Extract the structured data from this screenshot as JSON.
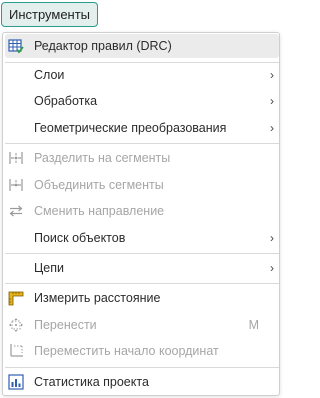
{
  "menubar": {
    "tools_label": "Инструменты"
  },
  "menu": {
    "drc": "Редактор правил (DRC)",
    "layers": "Слои",
    "processing": "Обработка",
    "geometry": "Геометрические преобразования",
    "split": "Разделить на сегменты",
    "merge": "Объединить сегменты",
    "reverse": "Сменить направление",
    "find": "Поиск объектов",
    "chains": "Цепи",
    "measure": "Измерить расстояние",
    "move": "Перенести",
    "move_shortcut": "M",
    "origin": "Переместить начало координат",
    "stats": "Статистика проекта",
    "submenu_arrow": "›"
  },
  "colors": {
    "accent": "#2c9a8c",
    "menubar_active_bg": "#e3efec",
    "highlight_bg": "#ebebeb",
    "disabled_text": "#a6a6a6"
  },
  "icons": {
    "drc": "table-check-icon",
    "split": "split-segments-icon",
    "merge": "merge-segments-icon",
    "reverse": "swap-direction-icon",
    "measure": "ruler-icon",
    "move": "move-icon",
    "origin": "origin-icon",
    "stats": "bar-chart-icon"
  }
}
